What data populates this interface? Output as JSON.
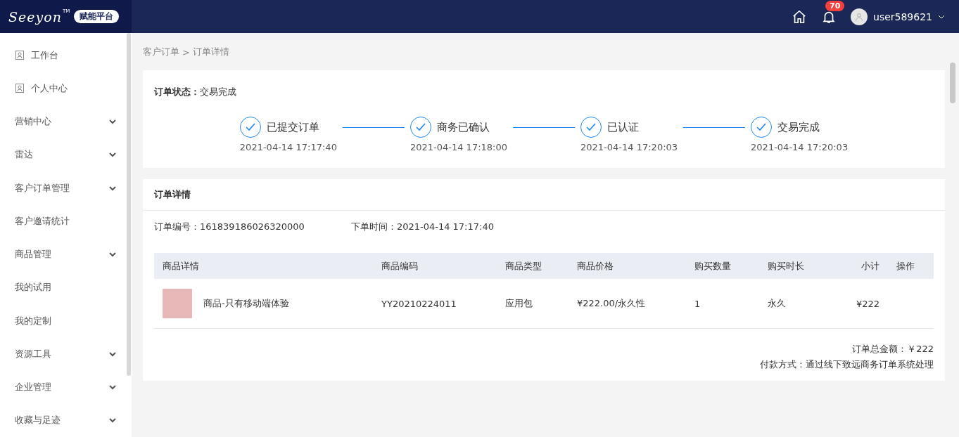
{
  "header": {
    "logo": "Seeyon",
    "logo_mark": "TM",
    "platform": "赋能平台",
    "notifications": "70",
    "user": "user589621"
  },
  "sidebar": {
    "items": [
      {
        "label": "工作台",
        "kind": "page"
      },
      {
        "label": "个人中心",
        "kind": "page"
      },
      {
        "label": "营销中心",
        "kind": "group",
        "expanded": false
      },
      {
        "label": "雷达",
        "kind": "group",
        "expanded": false
      },
      {
        "label": "客户订单管理",
        "kind": "group",
        "expanded": false
      },
      {
        "label": "客户邀请统计",
        "kind": "link"
      },
      {
        "label": "商品管理",
        "kind": "group",
        "expanded": false
      },
      {
        "label": "我的试用",
        "kind": "link"
      },
      {
        "label": "我的定制",
        "kind": "link"
      },
      {
        "label": "资源工具",
        "kind": "group",
        "expanded": false
      },
      {
        "label": "企业管理",
        "kind": "group",
        "expanded": false
      },
      {
        "label": "收藏与足迹",
        "kind": "group",
        "expanded": false
      }
    ]
  },
  "breadcrumb": [
    "客户订单",
    "订单详情"
  ],
  "breadcrumb_separator": ">",
  "status": {
    "label": "订单状态：",
    "value": "交易完成",
    "steps": [
      {
        "title": "已提交订单",
        "time": "2021-04-14 17:17:40",
        "done": true
      },
      {
        "title": "商务已确认",
        "time": "2021-04-14 17:18:00",
        "done": true
      },
      {
        "title": "已认证",
        "time": "2021-04-14 17:20:03",
        "done": true
      },
      {
        "title": "交易完成",
        "time": "2021-04-14 17:20:03",
        "done": true
      }
    ]
  },
  "details": {
    "title": "订单详情",
    "order_no": "订单编号：161839186026320000",
    "order_time": "下单时间：2021-04-14 17:17:40",
    "table": {
      "columns": [
        "商品详情",
        "商品编码",
        "商品类型",
        "商品价格",
        "购买数量",
        "购买时长",
        "小计",
        "操作"
      ],
      "rows": [
        [
          "商品-只有移动端体验",
          "YY20210224011",
          "应用包",
          "¥222.00/永久性",
          "1",
          "永久",
          "¥222",
          ""
        ]
      ]
    },
    "total": "订单总金额：￥222",
    "payment": "付款方式：通过线下致远商务订单系统处理"
  }
}
